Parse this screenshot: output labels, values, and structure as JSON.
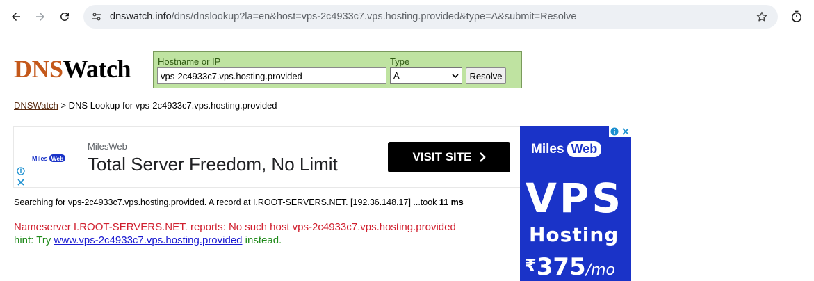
{
  "browser": {
    "url_host": "dnswatch.info",
    "url_path": "/dns/dnslookup?la=en&host=vps-2c4933c7.vps.hosting.provided&type=A&submit=Resolve"
  },
  "logo": {
    "part1": "DNS",
    "part2": "Watch"
  },
  "lookup": {
    "hostname_label": "Hostname or IP",
    "hostname_value": "vps-2c4933c7.vps.hosting.provided",
    "type_label": "Type",
    "type_value": "A",
    "resolve_label": "Resolve"
  },
  "breadcrumb": {
    "home": "DNSWatch",
    "separator": " > ",
    "current": "DNS Lookup for vps-2c4933c7.vps.hosting.provided"
  },
  "ad_top": {
    "logo_text": "MilesWeb",
    "brand": "MilesWeb",
    "headline": "Total Server Freedom, No Limit",
    "cta": "VISIT SITE"
  },
  "result": {
    "text": "Searching for vps-2c4933c7.vps.hosting.provided. A record at I.ROOT-SERVERS.NET. [192.36.148.17] ...took ",
    "duration": "11 ms"
  },
  "error": {
    "text": "Nameserver I.ROOT-SERVERS.NET. reports: No such host vps-2c4933c7.vps.hosting.provided"
  },
  "hint": {
    "prefix": "hint: Try ",
    "link": "www.vps-2c4933c7.vps.hosting.provided",
    "suffix": " instead."
  },
  "ad_side": {
    "brand_miles": "Miles",
    "brand_web": "Web",
    "product": "VPS",
    "product_sub": "Hosting",
    "currency": "₹",
    "price": "375",
    "per": "/mo"
  },
  "colors": {
    "accent_logo": "#c4581a",
    "form_bg": "#bfe3a1",
    "error": "#d01f2e",
    "hint": "#1f8a1a",
    "ad_blue": "#1a33c8"
  }
}
